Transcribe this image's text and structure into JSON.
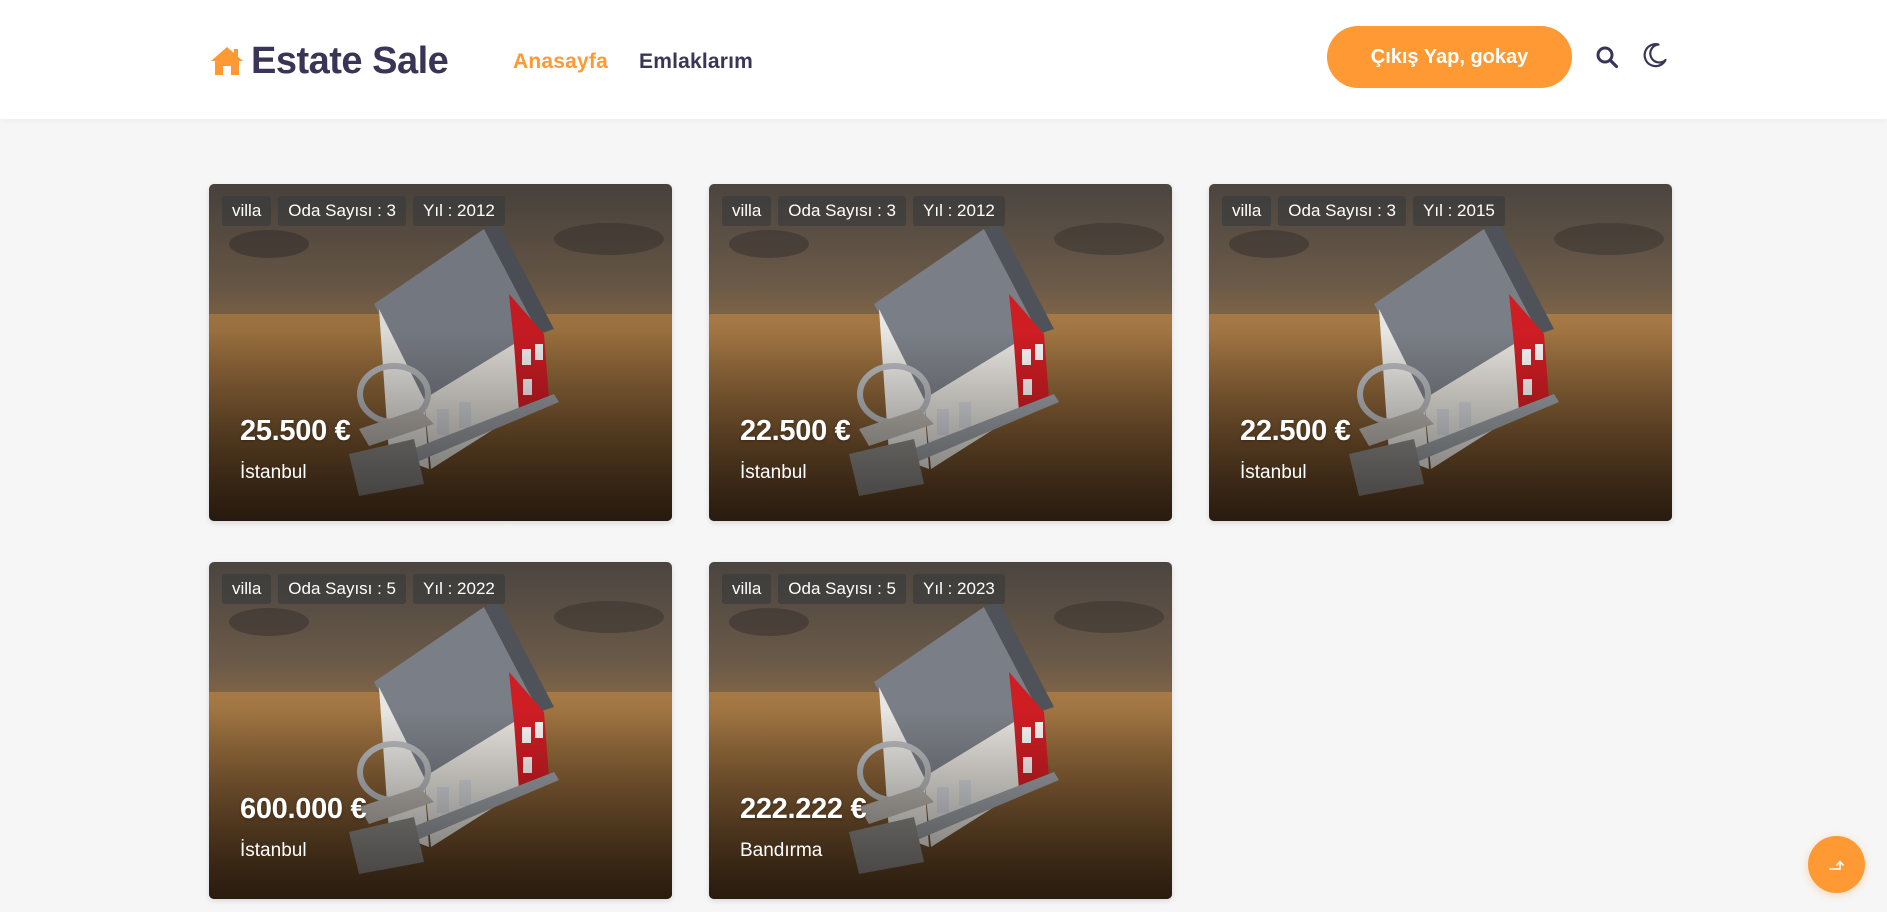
{
  "brand": {
    "name": "Estate Sale",
    "accent_color": "#ff9933",
    "text_color": "#3a3556",
    "icon": "house-icon"
  },
  "nav": {
    "items": [
      {
        "label": "Anasayfa",
        "active": true
      },
      {
        "label": "Emlaklarım",
        "active": false
      }
    ]
  },
  "header_actions": {
    "logout_label": "Çıkış Yap, gokay",
    "search_icon": "search-icon",
    "theme_icon": "moon-icon"
  },
  "listings": [
    {
      "type": "villa",
      "rooms": "Oda Sayısı : 3",
      "year": "Yıl : 2012",
      "price": "25.500 €",
      "city": "İstanbul"
    },
    {
      "type": "villa",
      "rooms": "Oda Sayısı : 3",
      "year": "Yıl : 2012",
      "price": "22.500 €",
      "city": "İstanbul"
    },
    {
      "type": "villa",
      "rooms": "Oda Sayısı : 3",
      "year": "Yıl : 2015",
      "price": "22.500 €",
      "city": "İstanbul"
    },
    {
      "type": "villa",
      "rooms": "Oda Sayısı : 5",
      "year": "Yıl : 2022",
      "price": "600.000 €",
      "city": "İstanbul"
    },
    {
      "type": "villa",
      "rooms": "Oda Sayısı : 5",
      "year": "Yıl : 2023",
      "price": "222.222 €",
      "city": "Bandırma"
    }
  ],
  "scroll_top": {
    "icon": "arrow-up-icon"
  }
}
